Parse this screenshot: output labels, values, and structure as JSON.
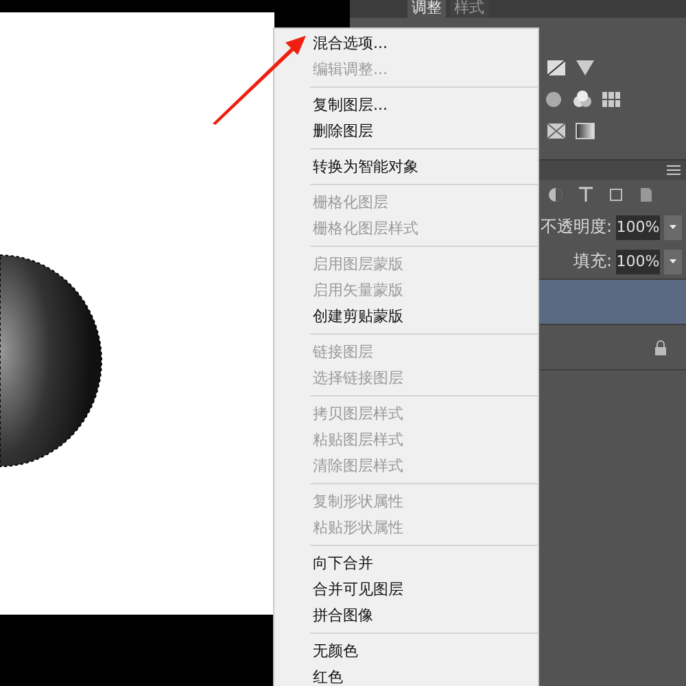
{
  "panel_tabs": [
    {
      "label": "调整",
      "selected": true
    },
    {
      "label": "样式",
      "selected": false
    }
  ],
  "layers_panel": {
    "opacity_label": "不透明度:",
    "opacity_value": "100%",
    "fill_label": "填充:",
    "fill_value": "100%",
    "layers": [
      {
        "selected": true,
        "locked": false
      },
      {
        "selected": false,
        "locked": true
      }
    ]
  },
  "context_menu": {
    "items": [
      {
        "kind": "item",
        "label": "混合选项...",
        "disabled": false
      },
      {
        "kind": "item",
        "label": "编辑调整...",
        "disabled": true
      },
      {
        "kind": "separator"
      },
      {
        "kind": "item",
        "label": "复制图层...",
        "disabled": false
      },
      {
        "kind": "item",
        "label": "删除图层",
        "disabled": false
      },
      {
        "kind": "separator"
      },
      {
        "kind": "item",
        "label": "转换为智能对象",
        "disabled": false
      },
      {
        "kind": "separator"
      },
      {
        "kind": "item",
        "label": "栅格化图层",
        "disabled": true
      },
      {
        "kind": "item",
        "label": "栅格化图层样式",
        "disabled": true
      },
      {
        "kind": "separator"
      },
      {
        "kind": "item",
        "label": "启用图层蒙版",
        "disabled": true
      },
      {
        "kind": "item",
        "label": "启用矢量蒙版",
        "disabled": true
      },
      {
        "kind": "item",
        "label": "创建剪贴蒙版",
        "disabled": false
      },
      {
        "kind": "separator"
      },
      {
        "kind": "item",
        "label": "链接图层",
        "disabled": true
      },
      {
        "kind": "item",
        "label": "选择链接图层",
        "disabled": true
      },
      {
        "kind": "separator"
      },
      {
        "kind": "item",
        "label": "拷贝图层样式",
        "disabled": true
      },
      {
        "kind": "item",
        "label": "粘贴图层样式",
        "disabled": true
      },
      {
        "kind": "item",
        "label": "清除图层样式",
        "disabled": true
      },
      {
        "kind": "separator"
      },
      {
        "kind": "item",
        "label": "复制形状属性",
        "disabled": true
      },
      {
        "kind": "item",
        "label": "粘贴形状属性",
        "disabled": true
      },
      {
        "kind": "separator"
      },
      {
        "kind": "item",
        "label": "向下合并",
        "disabled": false
      },
      {
        "kind": "item",
        "label": "合并可见图层",
        "disabled": false
      },
      {
        "kind": "item",
        "label": "拼合图像",
        "disabled": false
      },
      {
        "kind": "separator"
      },
      {
        "kind": "item",
        "label": "无颜色",
        "disabled": false
      },
      {
        "kind": "item",
        "label": "红色",
        "disabled": false
      }
    ]
  }
}
